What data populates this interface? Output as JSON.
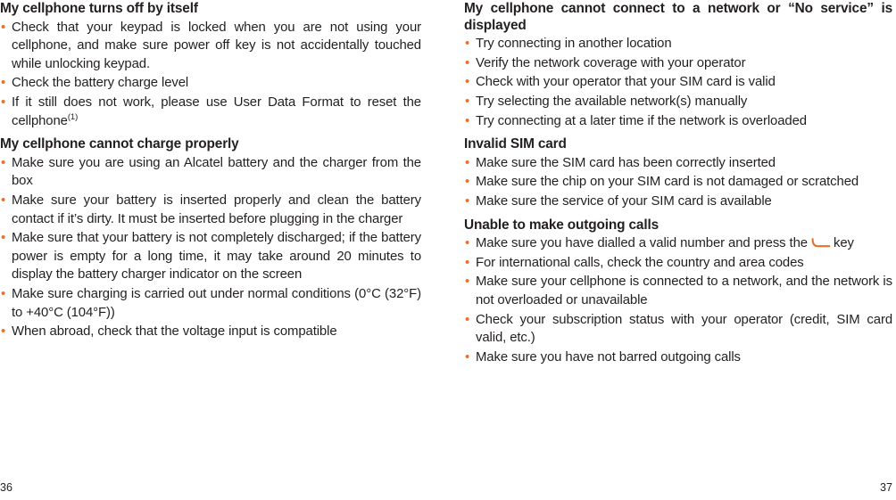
{
  "document": {
    "type": "cellphone-user-manual-troubleshooting-spread",
    "accent_color": "#e8712a",
    "text_color": "#231f20",
    "background_color": "#ffffff"
  },
  "left_page": {
    "page_number": "36",
    "sections": [
      {
        "heading": "My cellphone turns off by itself",
        "bullets": [
          "Check that your keypad is locked when you are not using your cellphone, and make sure power off key is not accidentally touched while unlocking keypad.",
          "Check the battery charge level",
          "If it still does not work, please use User Data Format to reset the cellphone"
        ],
        "footnote_marker": "(1)",
        "footnote_on_bullet_index": 2
      },
      {
        "heading": "My cellphone cannot charge properly",
        "bullets": [
          "Make sure you are using an Alcatel battery and the charger from the box",
          "Make sure your battery is inserted properly and clean the battery contact if it’s dirty. It must be inserted before plugging in the charger",
          "Make sure that your battery is not completely discharged; if the battery power is empty for a long time, it may take around 20 minutes to display the battery charger indicator on the screen",
          "Make sure charging is carried out under normal conditions (0°C (32°F) to +40°C (104°F))",
          "When abroad, check that the voltage input is compatible"
        ]
      }
    ]
  },
  "right_page": {
    "page_number": "37",
    "sections": [
      {
        "heading": "My cellphone cannot connect to a network or “No service” is displayed",
        "heading_justify": true,
        "bullets": [
          "Try connecting in another location",
          "Verify the network coverage with your operator",
          "Check with your operator that your SIM card is valid",
          "Try selecting the available network(s) manually",
          "Try connecting at a later time if the network is overloaded"
        ]
      },
      {
        "heading": "Invalid SIM card",
        "bullets": [
          "Make sure the SIM card has been correctly inserted",
          "Make sure the chip on your SIM card is not damaged or scratched",
          "Make sure the service of your SIM card is available"
        ]
      },
      {
        "heading": "Unable to make outgoing calls",
        "bullets_with_icon": [
          {
            "text_before": "Make sure you have dialled a valid number and press the",
            "icon": "call-key-icon",
            "text_after": "key"
          }
        ],
        "bullets": [
          "For international calls, check the country and area codes",
          "Make sure your cellphone is connected to a network, and the network is not overloaded or unavailable",
          "Check your subscription status with your operator (credit, SIM card valid, etc.)",
          "Make sure you have not barred outgoing calls"
        ]
      }
    ]
  }
}
